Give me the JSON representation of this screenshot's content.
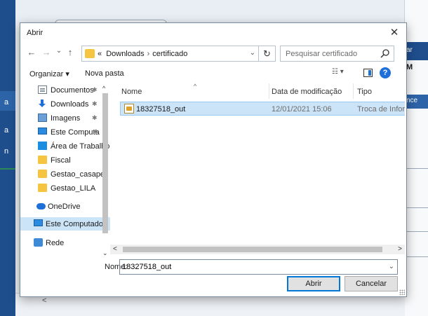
{
  "dialog": {
    "title": "Abrir",
    "close_icon": "close-icon"
  },
  "nav": {
    "back_icon": "←",
    "forward_icon": "→",
    "recent_icon": "⌄",
    "up_icon": "↑",
    "breadcrumbs": [
      "«",
      "Downloads",
      "certificado"
    ],
    "refresh_icon": "↻",
    "search_placeholder": "Pesquisar certificado"
  },
  "toolbar": {
    "organize_label": "Organizar ▾",
    "new_folder_label": "Nova pasta",
    "view_label": "☷ ▾",
    "help_label": "?"
  },
  "sidebar": {
    "items": [
      {
        "label": "Documentos",
        "icon": "document-icon",
        "pinned": true
      },
      {
        "label": "Downloads",
        "icon": "download-icon",
        "pinned": true
      },
      {
        "label": "Imagens",
        "icon": "image-icon",
        "pinned": true
      },
      {
        "label": "Este Computa",
        "icon": "computer-icon",
        "pinned": true
      },
      {
        "label": "Área de Trabalho",
        "icon": "desktop-icon",
        "pinned": false
      },
      {
        "label": "Fiscal",
        "icon": "folder-icon",
        "pinned": false
      },
      {
        "label": "Gestao_casapec",
        "icon": "folder-icon",
        "pinned": false
      },
      {
        "label": "Gestao_LILA",
        "icon": "folder-icon",
        "pinned": false
      },
      {
        "label": "OneDrive",
        "icon": "cloud-icon",
        "pinned": false
      },
      {
        "label": "Este Computador",
        "icon": "computer-icon",
        "pinned": false,
        "selected": true
      },
      {
        "label": "Rede",
        "icon": "network-icon",
        "pinned": false
      }
    ],
    "pin_glyph": "✱"
  },
  "filelist": {
    "columns": [
      "Nome",
      "Data de modificação",
      "Tipo"
    ],
    "rows": [
      {
        "name": "18327518_out",
        "modified": "12/01/2021 15:06",
        "type": "Troca de Informaç"
      }
    ]
  },
  "form": {
    "name_label": "Nome:",
    "name_value": "18327518_out",
    "open_label": "Abrir",
    "cancel_label": "Cancelar"
  },
  "background": {
    "left_letters": [
      "a",
      "n"
    ],
    "right_letters": [
      "ar",
      "M",
      "nce"
    ]
  }
}
